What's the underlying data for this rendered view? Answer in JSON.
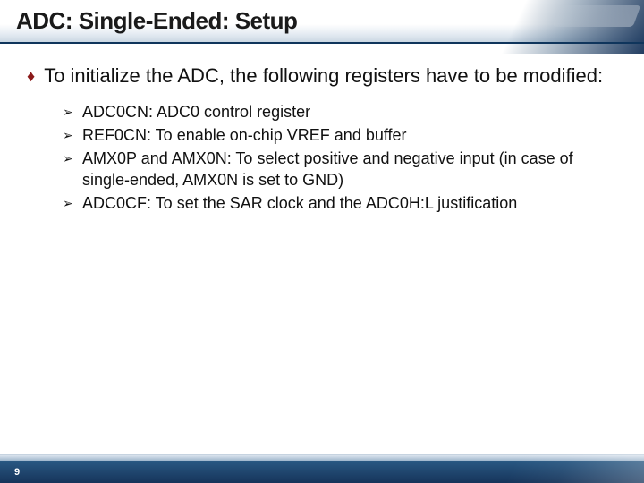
{
  "title": "ADC: Single-Ended: Setup",
  "intro": "To initialize the ADC, the following registers have to be modified:",
  "items": [
    "ADC0CN: ADC0 control register",
    "REF0CN: To enable on-chip VREF and buffer",
    "AMX0P and AMX0N: To select positive and negative input (in case of single-ended, AMX0N is set to GND)",
    "ADC0CF: To set the SAR clock and the ADC0H:L justification"
  ],
  "page_number": "9",
  "bullets": {
    "lvl1": "♦",
    "lvl2": "➢"
  }
}
